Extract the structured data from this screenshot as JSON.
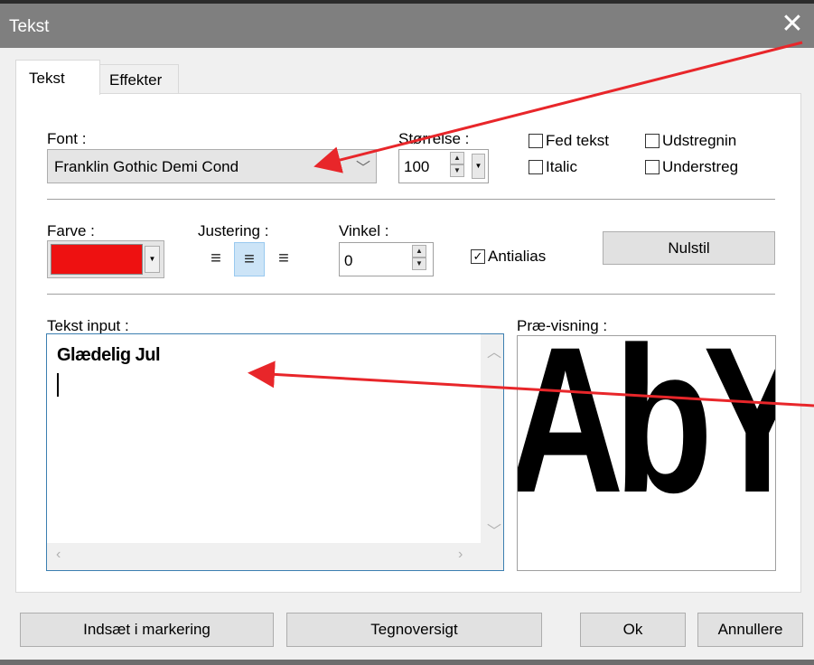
{
  "window": {
    "title": "Tekst",
    "close_glyph": "✕"
  },
  "tabs": [
    {
      "label": "Tekst",
      "active": true
    },
    {
      "label": "Effekter",
      "active": false
    }
  ],
  "font": {
    "label": "Font :",
    "value": "Franklin Gothic Demi Cond",
    "arrow_glyph": "﹀"
  },
  "size": {
    "label": "Størrelse :",
    "value": "100"
  },
  "style_options": [
    {
      "label": "Fed tekst",
      "checked": false
    },
    {
      "label": "Udstregnin",
      "checked": false
    },
    {
      "label": "Italic",
      "checked": false
    },
    {
      "label": "Understreg",
      "checked": false
    }
  ],
  "color": {
    "label": "Farve :",
    "value": "#ee1111"
  },
  "alignment": {
    "label": "Justering :",
    "options": [
      "left",
      "center",
      "right"
    ],
    "selected": "center"
  },
  "angle": {
    "label": "Vinkel :",
    "value": "0"
  },
  "antialias": {
    "label": "Antialias",
    "checked": true,
    "check_glyph": "✓"
  },
  "reset_button": "Nulstil",
  "text_input": {
    "label": "Tekst input :",
    "value": "Glædelig Jul"
  },
  "preview": {
    "label": "Præ-visning :",
    "sample": "AbYz"
  },
  "buttons": {
    "insert": "Indsæt i markering",
    "charmap": "Tegnoversigt",
    "ok": "Ok",
    "cancel": "Annullere"
  },
  "annotation_color": "#e8262a"
}
